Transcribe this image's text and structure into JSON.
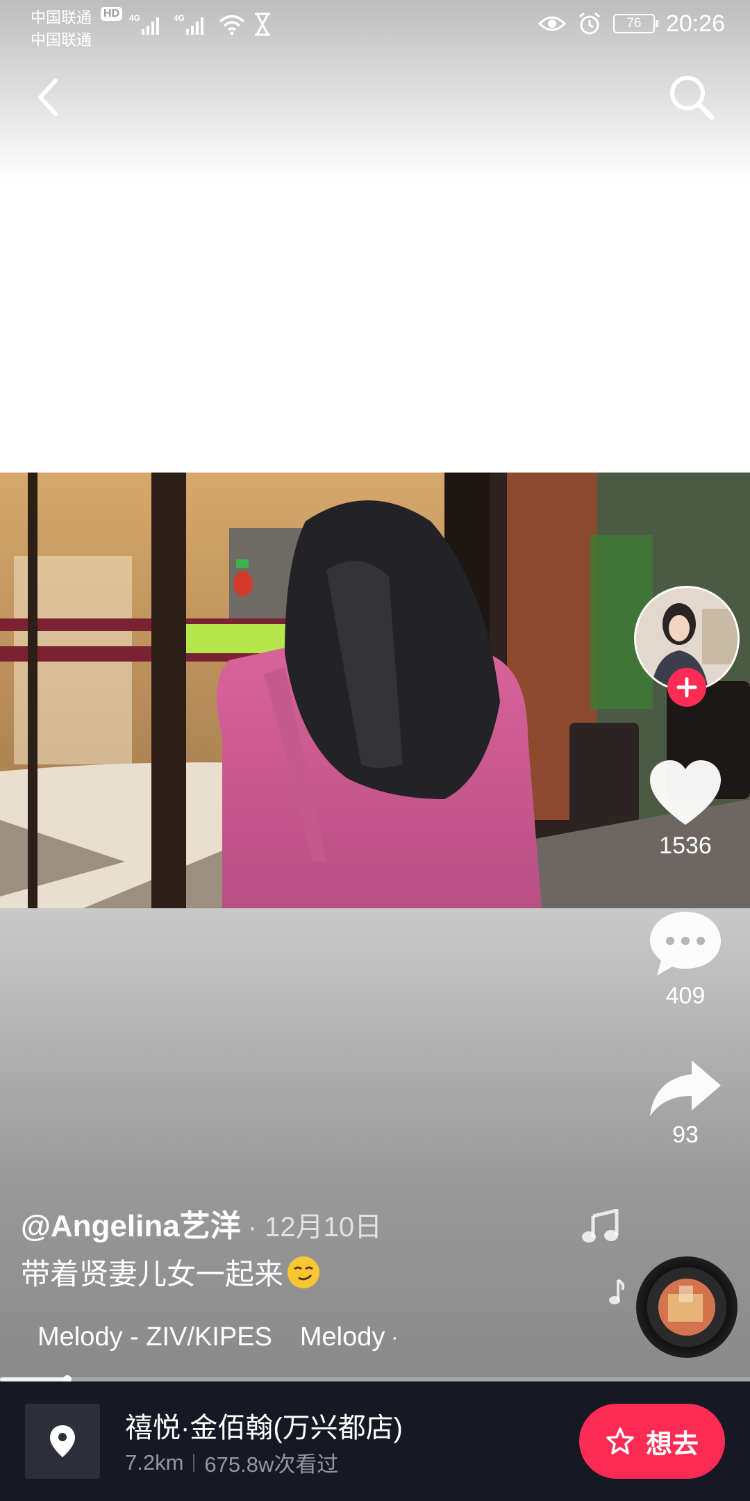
{
  "status_bar": {
    "carrier_1": "中国联通",
    "carrier_2": "中国联通",
    "hd": "HD",
    "net_1": "4G",
    "net_2": "4G",
    "battery": "76",
    "time": "20:26"
  },
  "icons": {
    "back": "chevron-left-icon",
    "search": "search-icon",
    "like": "heart-icon",
    "comment": "comment-bubble-icon",
    "share": "share-arrow-icon",
    "music": "music-note-icon",
    "tiktok": "tiktok-logo-icon",
    "location": "location-pin-icon",
    "star": "star-icon"
  },
  "video": {
    "likes": "1536",
    "comments": "409",
    "shares": "93",
    "progress": 0.09
  },
  "post": {
    "author": "@Angelina艺洋",
    "date": "· 12月10日",
    "caption": "带着贤妻儿女一起来",
    "caption_emoji": "smirk-emoji",
    "music": "Melody - ZIV/KIPES",
    "music_repeat": "Melody - ZIV/KIPES"
  },
  "poi": {
    "name": "禧悦·金佰翰(万兴都店)",
    "distance": "7.2km",
    "views": "675.8w次看过",
    "want_label": "想去"
  },
  "colors": {
    "accent": "#fe2c55",
    "poi_bar": "#161823"
  }
}
